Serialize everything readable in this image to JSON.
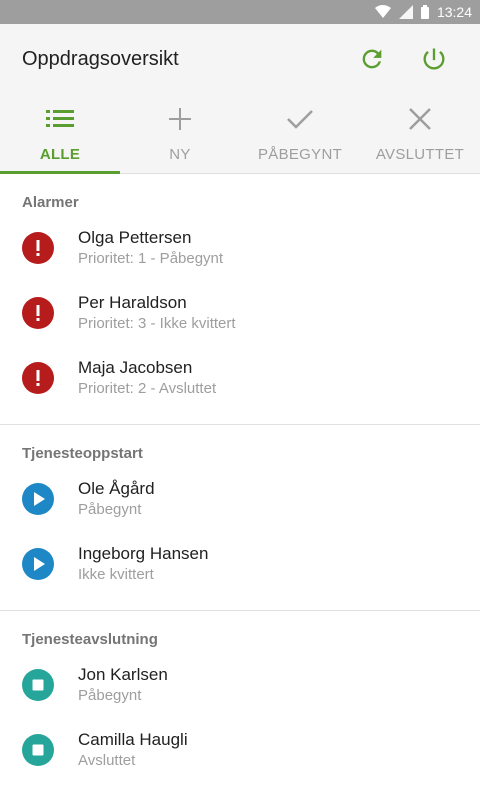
{
  "statusbar": {
    "time": "13:24"
  },
  "appbar": {
    "title": "Oppdragsoversikt"
  },
  "tabs": [
    {
      "label": "ALLE",
      "icon": "list-icon",
      "active": true
    },
    {
      "label": "NY",
      "icon": "plus-icon",
      "active": false
    },
    {
      "label": "PÅBEGYNT",
      "icon": "check-icon",
      "active": false
    },
    {
      "label": "AVSLUTTET",
      "icon": "close-icon",
      "active": false
    }
  ],
  "sections": [
    {
      "header": "Alarmer",
      "icon": "alert-icon",
      "color": "#b71c1c",
      "items": [
        {
          "name": "Olga Pettersen",
          "sub": "Prioritet: 1 - Påbegynt"
        },
        {
          "name": "Per Haraldson",
          "sub": "Prioritet: 3 - Ikke kvittert"
        },
        {
          "name": "Maja Jacobsen",
          "sub": "Prioritet: 2 - Avsluttet"
        }
      ]
    },
    {
      "header": "Tjenesteoppstart",
      "icon": "play-icon",
      "color": "#1e88c7",
      "items": [
        {
          "name": "Ole Ågård",
          "sub": "Påbegynt"
        },
        {
          "name": "Ingeborg Hansen",
          "sub": "Ikke kvittert"
        }
      ]
    },
    {
      "header": "Tjenesteavslutning",
      "icon": "stop-icon",
      "color": "#26a69a",
      "items": [
        {
          "name": "Jon Karlsen",
          "sub": "Påbegynt"
        },
        {
          "name": "Camilla Haugli",
          "sub": "Avsluttet"
        }
      ]
    }
  ],
  "colors": {
    "accent": "#5a9e2f",
    "inactive": "#9e9e9e"
  }
}
